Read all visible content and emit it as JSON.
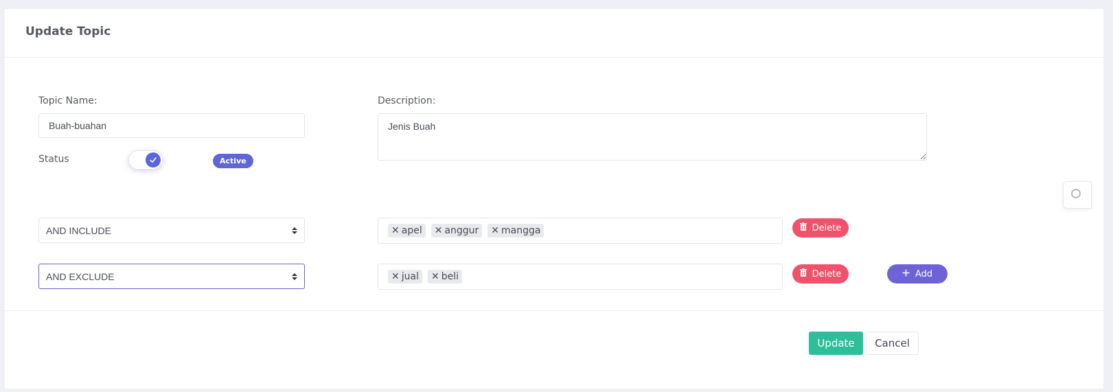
{
  "card": {
    "title": "Update Topic"
  },
  "form": {
    "topic_name_label": "Topic Name:",
    "topic_name_value": "Buah-buahan",
    "description_label": "Description:",
    "description_value": "Jenis Buah",
    "status_label": "Status",
    "status_enabled": true,
    "status_badge": "Active"
  },
  "rules": [
    {
      "operator": "AND INCLUDE",
      "keywords": [
        "apel",
        "anggur",
        "mangga"
      ],
      "delete_label": "Delete"
    },
    {
      "operator": "AND EXCLUDE",
      "keywords": [
        "jual",
        "beli"
      ],
      "delete_label": "Delete"
    }
  ],
  "add_label": "Add",
  "actions": {
    "update_label": "Update",
    "cancel_label": "Cancel"
  },
  "colors": {
    "accent": "#5a67d8",
    "delete": "#f1526b",
    "add": "#6d63d6",
    "update": "#2dbf9a"
  },
  "icons": {
    "toggle": "check-icon",
    "delete": "trash-icon",
    "add": "plus-icon",
    "tag_remove": "close-icon",
    "select": "chevron-updown-icon"
  }
}
